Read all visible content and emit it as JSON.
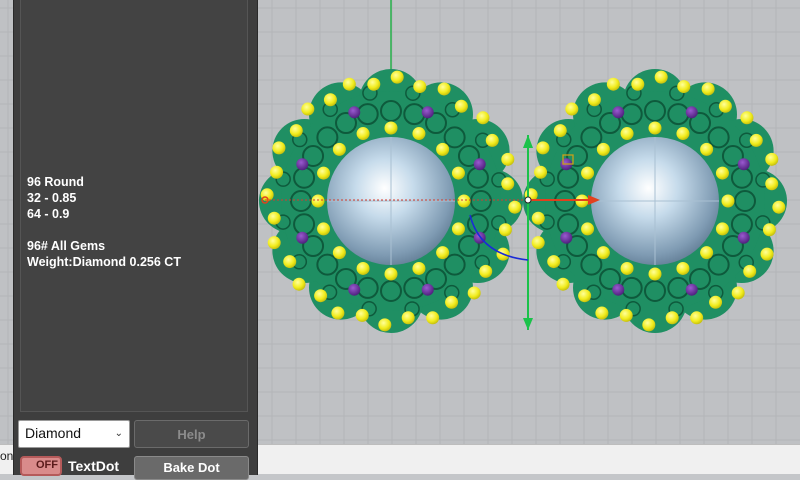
{
  "viewport": {
    "status_fragment": "on",
    "jewelry_pieces": [
      "left-earring",
      "right-earring"
    ]
  },
  "panel": {
    "info_lines": [
      "96 Round",
      "32 - 0.85",
      "64 - 0.9",
      "",
      "96# All Gems",
      "Weight:Diamond 0.256 CT"
    ],
    "gem_type_selected": "Diamond",
    "help_label": "Help",
    "textdot_toggle_label": "OFF",
    "textdot_label": "TextDot",
    "bake_dot_label": "Bake Dot"
  },
  "colors": {
    "viewport_bg": "#bfc1c4",
    "metal_green": "#1f8f63",
    "diamond_yellow": "#f1ec1c",
    "amethyst_purple": "#6a2ea0",
    "pearl": "#b9d3e6",
    "gumball_green": "#19c24a",
    "gumball_red": "#e2401d"
  }
}
